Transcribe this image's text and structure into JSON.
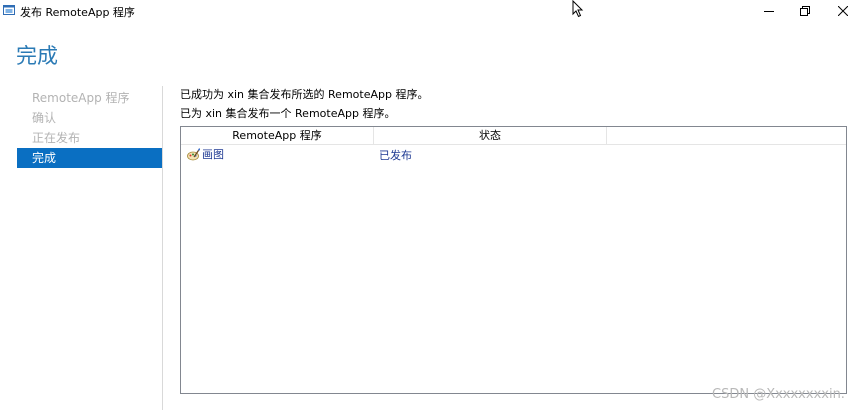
{
  "window": {
    "title": "发布 RemoteApp 程序",
    "icon": "remoteapp-app-icon"
  },
  "page_title": "完成",
  "nav": {
    "items": [
      {
        "label": "RemoteApp 程序",
        "state": "disabled"
      },
      {
        "label": "确认",
        "state": "disabled"
      },
      {
        "label": "正在发布",
        "state": "disabled"
      },
      {
        "label": "完成",
        "state": "active"
      }
    ]
  },
  "messages": {
    "line1": "已成功为 xin 集合发布所选的 RemoteApp 程序。",
    "line2": "已为 xin 集合发布一个 RemoteApp 程序。"
  },
  "table": {
    "columns": [
      "RemoteApp 程序",
      "状态"
    ],
    "rows": [
      {
        "name": "画图",
        "status": "已发布",
        "icon": "paint-icon"
      }
    ]
  },
  "watermark": "CSDN @Xxxxxxxxin.",
  "colors": {
    "accent": "#2a7ab5",
    "nav_active_bg": "#0a6fc2",
    "link_text": "#1f3a93",
    "disabled_text": "#b3b3b3"
  }
}
